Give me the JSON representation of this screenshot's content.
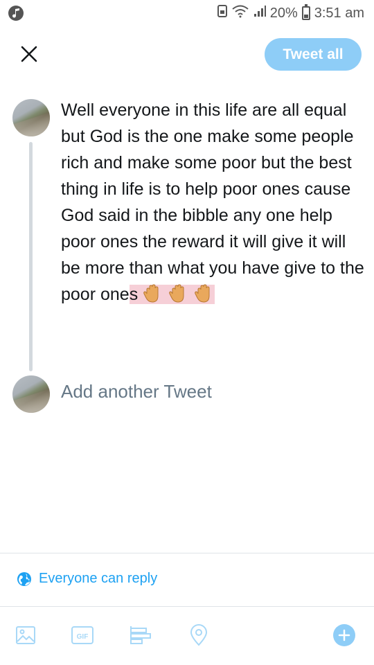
{
  "status_bar": {
    "wifi_icon": "wifi-icon",
    "signal_icon": "signal-icon",
    "battery_percent": "20%",
    "time": "3:51 am"
  },
  "header": {
    "close_icon": "close-icon",
    "tweet_all_label": "Tweet all"
  },
  "thread": {
    "tweet_text_main": "Well everyone in this life are all equal but God is the one make some people rich and make some poor but the best thing in life is to help poor ones cause God said in the bibble any one help poor ones the reward it will give it will be more than what you have give to the poor one",
    "tweet_text_highlight": "s",
    "emojis": [
      "raised-hand-emoji",
      "raised-hand-emoji",
      "raised-hand-emoji"
    ],
    "add_placeholder": "Add another Tweet"
  },
  "reply_setting": {
    "icon": "globe-icon",
    "label": "Everyone can reply"
  },
  "toolbar": {
    "items": [
      "image-icon",
      "gif-icon",
      "poll-icon",
      "location-icon",
      "add-tweet-icon"
    ],
    "gif_label": "GIF"
  },
  "colors": {
    "accent": "#1da1f2",
    "button_disabled": "#8ecdf7",
    "highlight": "#f6cfd7",
    "placeholder": "#657786"
  }
}
